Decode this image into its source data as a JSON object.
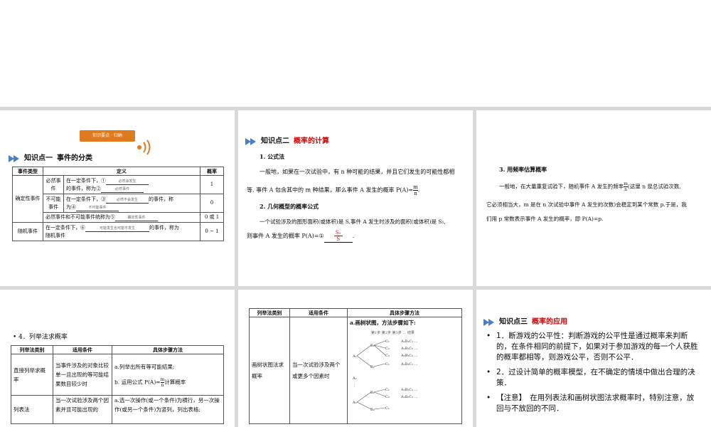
{
  "slide1": {
    "badge": "知识要点 · 归纳",
    "kp_label": "知识点一",
    "kp_title": "事件的分类",
    "headers": [
      "事件类型",
      "定义",
      "概率"
    ],
    "group_certain": "确定性事件",
    "sure": "必然事件",
    "sure_def_a": "在一定条件下，①",
    "sure_def_b": "的事件，称为②",
    "sure_blank1": "必然会发生",
    "sure_blank2": "必然事件",
    "sure_p": "1",
    "impossible": "不可能事件",
    "imp_def_a": "在一定条件下，③",
    "imp_blank1": "必然不会发生",
    "imp_def_b": "的事件，称",
    "imp_def_c": "为④",
    "imp_blank2": "不可能事件",
    "imp_p": "0",
    "combined_a": "必然事件和不可能事件统称为⑤",
    "combined_blank": "确定性事件",
    "combined_p": "0 或 1",
    "random": "随机事件",
    "rand_def_a": "在一定条件下，⑥",
    "rand_blank": "可能发生也可能不发生",
    "rand_def_b": "的事件，称为",
    "rand_def_c": "随机事件",
    "rand_p": "0 ~ 1"
  },
  "slide2": {
    "kp_label": "知识点二",
    "kp_title": "概率的计算",
    "h1": "1. 公式法",
    "p1a": "一般地，如果在一次试验中，有 n 种可能的结果，并且它们发生的可能性都相",
    "p1b": "等. 事件 A 包含其中的 m 种结果，那么事件 A 发生的概率 P(A)=",
    "p1_num": "m",
    "p1_den": "n",
    "h2": "2. 几何概型的概率公式",
    "p2a": "一个试验涉及的图形面积(或体积)是 S,事件 A 发生时涉及的面积(或体积)是 S₁,",
    "p2b": "则事件 A 发生的概率 P(A)=①",
    "p2_num": "S₁",
    "p2_den": "S"
  },
  "slide3": {
    "h": "3. 用频率估算概率",
    "p_a": "一般地，在大量重复试验下，随机事件 A 发生的频率",
    "frac_num": "m",
    "frac_den": "n",
    "p_b": "(这里 n 是总试验次数,",
    "p_c": "它必须相当大，m 是在 n 次试验中事件 A 发生的次数)会稳定到某个常数 p.于是，我",
    "p_d": "们用 p 常数表示事件 A 发生的概率，即 P(A)=p."
  },
  "slide4": {
    "heading": "• 4．列举法求概率",
    "headers": [
      "列举法类别",
      "适用条件",
      "具体步骤方法"
    ],
    "r1_type": "直接列举求概率",
    "r1_cond": "当事件涉及的对象比较单一且出现的等可能结果数目较少时",
    "r1_step1": "a.列举出所有等可能结果;",
    "r1_step2a": "b. 运用公式 P(A)=",
    "r1_num": "m",
    "r1_den": "n",
    "r1_step2b": "计算概率",
    "r2_type": "列表法",
    "r2_cond": "当一次试验涉及两个因素并且可能出现的",
    "r2_step": "a.选一次操作(或一个条件)为横行，另一次操作(或另一个条件)为竖列，列出表格;"
  },
  "slide5": {
    "headers": [
      "列举法类别",
      "适用条件",
      "具体步骤方法"
    ],
    "type": "画树状图法求概率",
    "cond": "当一次试验涉及两个或更多个因素时",
    "step": "a.画树状图，方法步骤如下:",
    "tree_header": "第1步 第2步 第3步 …  结果",
    "tree_results": [
      "A₁B₁C₁ …",
      "A₁B₁C₂ …",
      "A₁B₁C₃ …",
      "A₁B₂C₁ …",
      "A₂B₁C₁ …",
      "A₂B₂C₁ …"
    ]
  },
  "slide6": {
    "kp_label": "知识点三",
    "kp_title": "概率的应用",
    "items": [
      "1．断游戏的公平性：判断游戏的公平性是通过概率来判断的，在条件相同的前提下，如果对于参加游戏的每一个人获胜的概率都相等，则游戏公平，否则不公平．",
      "2．过设计简单的概率模型，在不确定的情境中做出合理的决策．",
      "【注意】　在用列表法和画树状图法求概率时，特别注意，放回与不放回的不同．"
    ]
  },
  "colors": {
    "accent_red": "#e00000",
    "arrow_blue": "#4a7ec9",
    "badge": "#e07a1f"
  }
}
